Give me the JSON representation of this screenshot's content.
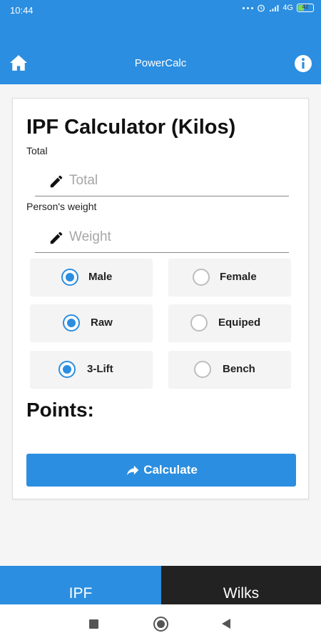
{
  "status_bar": {
    "time": "10:44",
    "network": "4G",
    "battery": "42"
  },
  "app_bar": {
    "title": "PowerCalc",
    "home_icon": "home-icon",
    "info_icon": "info-icon"
  },
  "calculator": {
    "title": "IPF Calculator (Kilos)",
    "total": {
      "label": "Total",
      "placeholder": "Total",
      "value": ""
    },
    "weight": {
      "label": "Person's weight",
      "placeholder": "Weight",
      "value": ""
    },
    "options": {
      "sex": [
        {
          "label": "Male",
          "selected": true
        },
        {
          "label": "Female",
          "selected": false
        }
      ],
      "equipment": [
        {
          "label": "Raw",
          "selected": true
        },
        {
          "label": "Equiped",
          "selected": false
        }
      ],
      "event": [
        {
          "label": "3-Lift",
          "selected": true
        },
        {
          "label": "Bench",
          "selected": false
        }
      ]
    },
    "points_label": "Points:",
    "calculate_button": "Calculate"
  },
  "tabs": [
    {
      "label": "IPF",
      "active": true
    },
    {
      "label": "Wilks",
      "active": false
    }
  ],
  "colors": {
    "primary": "#2b8ee0",
    "tab_inactive": "#222222",
    "radio_off": "#bdbdbd"
  }
}
